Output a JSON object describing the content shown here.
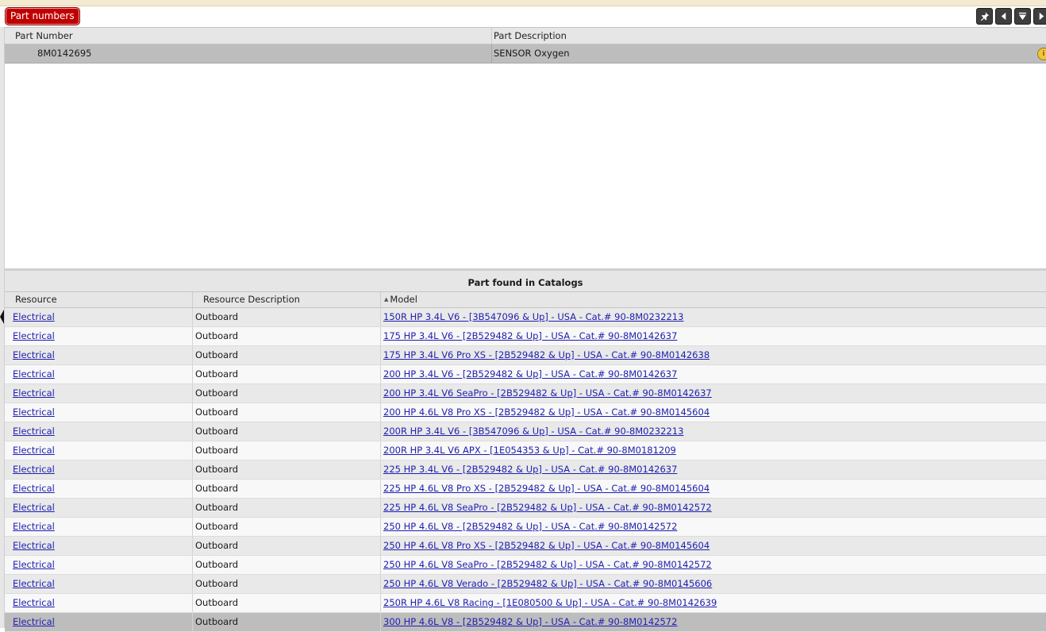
{
  "header": {
    "tab_label": "Part numbers"
  },
  "parts_table": {
    "columns": [
      "Part Number",
      "Part Description"
    ],
    "selected_row": {
      "part_number": "8M0142695",
      "description": "SENSOR Oxygen"
    }
  },
  "catalogs": {
    "title": "Part found in Catalogs",
    "columns": [
      "Resource",
      "Resource Description",
      "Model"
    ],
    "rows": [
      {
        "resource": "Electrical",
        "desc": "Outboard",
        "model": "150R HP 3.4L V6 - [3B547096 & Up] - USA - Cat.# 90-8M0232213"
      },
      {
        "resource": "Electrical",
        "desc": "Outboard",
        "model": "175 HP 3.4L V6 - [2B529482 & Up] - USA - Cat.# 90-8M0142637"
      },
      {
        "resource": "Electrical",
        "desc": "Outboard",
        "model": "175 HP 3.4L V6 Pro XS - [2B529482 & Up] - USA - Cat.# 90-8M0142638"
      },
      {
        "resource": "Electrical",
        "desc": "Outboard",
        "model": "200 HP 3.4L V6 - [2B529482 & Up] - USA - Cat.# 90-8M0142637"
      },
      {
        "resource": "Electrical",
        "desc": "Outboard",
        "model": "200 HP 3.4L V6 SeaPro - [2B529482 & Up] - USA - Cat.# 90-8M0142637"
      },
      {
        "resource": "Electrical",
        "desc": "Outboard",
        "model": "200 HP 4.6L V8 Pro XS - [2B529482 & Up] - USA - Cat.# 90-8M0145604"
      },
      {
        "resource": "Electrical",
        "desc": "Outboard",
        "model": "200R HP 3.4L V6 - [3B547096 & Up] - USA - Cat.# 90-8M0232213"
      },
      {
        "resource": "Electrical",
        "desc": "Outboard",
        "model": "200R HP 3.4L V6 APX - [1E054353 & Up] - Cat.# 90-8M0181209"
      },
      {
        "resource": "Electrical",
        "desc": "Outboard",
        "model": "225 HP 3.4L V6 - [2B529482 & Up] - USA - Cat.# 90-8M0142637"
      },
      {
        "resource": "Electrical",
        "desc": "Outboard",
        "model": "225 HP 4.6L V8 Pro XS - [2B529482 & Up] - USA - Cat.# 90-8M0145604"
      },
      {
        "resource": "Electrical",
        "desc": "Outboard",
        "model": "225 HP 4.6L V8 SeaPro - [2B529482 & Up] - USA - Cat.# 90-8M0142572"
      },
      {
        "resource": "Electrical",
        "desc": "Outboard",
        "model": "250 HP 4.6L V8 - [2B529482 & Up] - USA - Cat.# 90-8M0142572"
      },
      {
        "resource": "Electrical",
        "desc": "Outboard",
        "model": "250 HP 4.6L V8 Pro XS - [2B529482 & Up] - USA - Cat.# 90-8M0145604"
      },
      {
        "resource": "Electrical",
        "desc": "Outboard",
        "model": "250 HP 4.6L V8 SeaPro - [2B529482 & Up] - USA - Cat.# 90-8M0142572"
      },
      {
        "resource": "Electrical",
        "desc": "Outboard",
        "model": "250 HP 4.6L V8 Verado - [2B529482 & Up] - USA - Cat.# 90-8M0145606"
      },
      {
        "resource": "Electrical",
        "desc": "Outboard",
        "model": "250R HP 4.6L V8 Racing - [1E080500 & Up] - USA - Cat.# 90-8M0142639"
      },
      {
        "resource": "Electrical",
        "desc": "Outboard",
        "model": "300 HP 4.6L V8 - [2B529482 & Up] - USA - Cat.# 90-8M0142572"
      }
    ]
  },
  "icons": [
    "pin-icon",
    "prev-icon",
    "filter-icon",
    "next-icon",
    "info-icon"
  ]
}
